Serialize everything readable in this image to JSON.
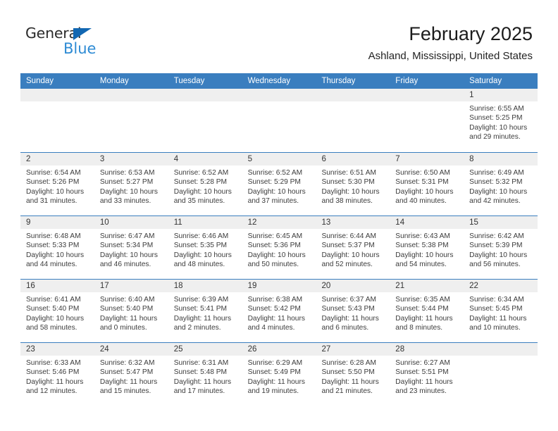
{
  "brand": {
    "name_top": "General",
    "name_bottom": "Blue",
    "triangle_color": "#1267b2",
    "blue_text_color": "#2e8bd4"
  },
  "header": {
    "title": "February 2025",
    "subtitle": "Ashland, Mississippi, United States"
  },
  "theme": {
    "header_bg": "#3a7ebf",
    "header_text": "#ffffff",
    "daynum_bg": "#efefef",
    "cell_bg": "#ffffff",
    "row_divider": "#3a7ebf"
  },
  "weekday_headers": [
    "Sunday",
    "Monday",
    "Tuesday",
    "Wednesday",
    "Thursday",
    "Friday",
    "Saturday"
  ],
  "labels": {
    "sunrise_prefix": "Sunrise:",
    "sunset_prefix": "Sunset:",
    "daylight_prefix": "Daylight:"
  },
  "weeks": [
    [
      {
        "day": "",
        "sunrise": "",
        "sunset": "",
        "daylight": "",
        "empty": true
      },
      {
        "day": "",
        "sunrise": "",
        "sunset": "",
        "daylight": "",
        "empty": true
      },
      {
        "day": "",
        "sunrise": "",
        "sunset": "",
        "daylight": "",
        "empty": true
      },
      {
        "day": "",
        "sunrise": "",
        "sunset": "",
        "daylight": "",
        "empty": true
      },
      {
        "day": "",
        "sunrise": "",
        "sunset": "",
        "daylight": "",
        "empty": true
      },
      {
        "day": "",
        "sunrise": "",
        "sunset": "",
        "daylight": "",
        "empty": true
      },
      {
        "day": "1",
        "sunrise": "Sunrise: 6:55 AM",
        "sunset": "Sunset: 5:25 PM",
        "daylight": "Daylight: 10 hours and 29 minutes.",
        "empty": false
      }
    ],
    [
      {
        "day": "2",
        "sunrise": "Sunrise: 6:54 AM",
        "sunset": "Sunset: 5:26 PM",
        "daylight": "Daylight: 10 hours and 31 minutes.",
        "empty": false
      },
      {
        "day": "3",
        "sunrise": "Sunrise: 6:53 AM",
        "sunset": "Sunset: 5:27 PM",
        "daylight": "Daylight: 10 hours and 33 minutes.",
        "empty": false
      },
      {
        "day": "4",
        "sunrise": "Sunrise: 6:52 AM",
        "sunset": "Sunset: 5:28 PM",
        "daylight": "Daylight: 10 hours and 35 minutes.",
        "empty": false
      },
      {
        "day": "5",
        "sunrise": "Sunrise: 6:52 AM",
        "sunset": "Sunset: 5:29 PM",
        "daylight": "Daylight: 10 hours and 37 minutes.",
        "empty": false
      },
      {
        "day": "6",
        "sunrise": "Sunrise: 6:51 AM",
        "sunset": "Sunset: 5:30 PM",
        "daylight": "Daylight: 10 hours and 38 minutes.",
        "empty": false
      },
      {
        "day": "7",
        "sunrise": "Sunrise: 6:50 AM",
        "sunset": "Sunset: 5:31 PM",
        "daylight": "Daylight: 10 hours and 40 minutes.",
        "empty": false
      },
      {
        "day": "8",
        "sunrise": "Sunrise: 6:49 AM",
        "sunset": "Sunset: 5:32 PM",
        "daylight": "Daylight: 10 hours and 42 minutes.",
        "empty": false
      }
    ],
    [
      {
        "day": "9",
        "sunrise": "Sunrise: 6:48 AM",
        "sunset": "Sunset: 5:33 PM",
        "daylight": "Daylight: 10 hours and 44 minutes.",
        "empty": false
      },
      {
        "day": "10",
        "sunrise": "Sunrise: 6:47 AM",
        "sunset": "Sunset: 5:34 PM",
        "daylight": "Daylight: 10 hours and 46 minutes.",
        "empty": false
      },
      {
        "day": "11",
        "sunrise": "Sunrise: 6:46 AM",
        "sunset": "Sunset: 5:35 PM",
        "daylight": "Daylight: 10 hours and 48 minutes.",
        "empty": false
      },
      {
        "day": "12",
        "sunrise": "Sunrise: 6:45 AM",
        "sunset": "Sunset: 5:36 PM",
        "daylight": "Daylight: 10 hours and 50 minutes.",
        "empty": false
      },
      {
        "day": "13",
        "sunrise": "Sunrise: 6:44 AM",
        "sunset": "Sunset: 5:37 PM",
        "daylight": "Daylight: 10 hours and 52 minutes.",
        "empty": false
      },
      {
        "day": "14",
        "sunrise": "Sunrise: 6:43 AM",
        "sunset": "Sunset: 5:38 PM",
        "daylight": "Daylight: 10 hours and 54 minutes.",
        "empty": false
      },
      {
        "day": "15",
        "sunrise": "Sunrise: 6:42 AM",
        "sunset": "Sunset: 5:39 PM",
        "daylight": "Daylight: 10 hours and 56 minutes.",
        "empty": false
      }
    ],
    [
      {
        "day": "16",
        "sunrise": "Sunrise: 6:41 AM",
        "sunset": "Sunset: 5:40 PM",
        "daylight": "Daylight: 10 hours and 58 minutes.",
        "empty": false
      },
      {
        "day": "17",
        "sunrise": "Sunrise: 6:40 AM",
        "sunset": "Sunset: 5:40 PM",
        "daylight": "Daylight: 11 hours and 0 minutes.",
        "empty": false
      },
      {
        "day": "18",
        "sunrise": "Sunrise: 6:39 AM",
        "sunset": "Sunset: 5:41 PM",
        "daylight": "Daylight: 11 hours and 2 minutes.",
        "empty": false
      },
      {
        "day": "19",
        "sunrise": "Sunrise: 6:38 AM",
        "sunset": "Sunset: 5:42 PM",
        "daylight": "Daylight: 11 hours and 4 minutes.",
        "empty": false
      },
      {
        "day": "20",
        "sunrise": "Sunrise: 6:37 AM",
        "sunset": "Sunset: 5:43 PM",
        "daylight": "Daylight: 11 hours and 6 minutes.",
        "empty": false
      },
      {
        "day": "21",
        "sunrise": "Sunrise: 6:35 AM",
        "sunset": "Sunset: 5:44 PM",
        "daylight": "Daylight: 11 hours and 8 minutes.",
        "empty": false
      },
      {
        "day": "22",
        "sunrise": "Sunrise: 6:34 AM",
        "sunset": "Sunset: 5:45 PM",
        "daylight": "Daylight: 11 hours and 10 minutes.",
        "empty": false
      }
    ],
    [
      {
        "day": "23",
        "sunrise": "Sunrise: 6:33 AM",
        "sunset": "Sunset: 5:46 PM",
        "daylight": "Daylight: 11 hours and 12 minutes.",
        "empty": false
      },
      {
        "day": "24",
        "sunrise": "Sunrise: 6:32 AM",
        "sunset": "Sunset: 5:47 PM",
        "daylight": "Daylight: 11 hours and 15 minutes.",
        "empty": false
      },
      {
        "day": "25",
        "sunrise": "Sunrise: 6:31 AM",
        "sunset": "Sunset: 5:48 PM",
        "daylight": "Daylight: 11 hours and 17 minutes.",
        "empty": false
      },
      {
        "day": "26",
        "sunrise": "Sunrise: 6:29 AM",
        "sunset": "Sunset: 5:49 PM",
        "daylight": "Daylight: 11 hours and 19 minutes.",
        "empty": false
      },
      {
        "day": "27",
        "sunrise": "Sunrise: 6:28 AM",
        "sunset": "Sunset: 5:50 PM",
        "daylight": "Daylight: 11 hours and 21 minutes.",
        "empty": false
      },
      {
        "day": "28",
        "sunrise": "Sunrise: 6:27 AM",
        "sunset": "Sunset: 5:51 PM",
        "daylight": "Daylight: 11 hours and 23 minutes.",
        "empty": false
      },
      {
        "day": "",
        "sunrise": "",
        "sunset": "",
        "daylight": "",
        "empty": true
      }
    ]
  ]
}
